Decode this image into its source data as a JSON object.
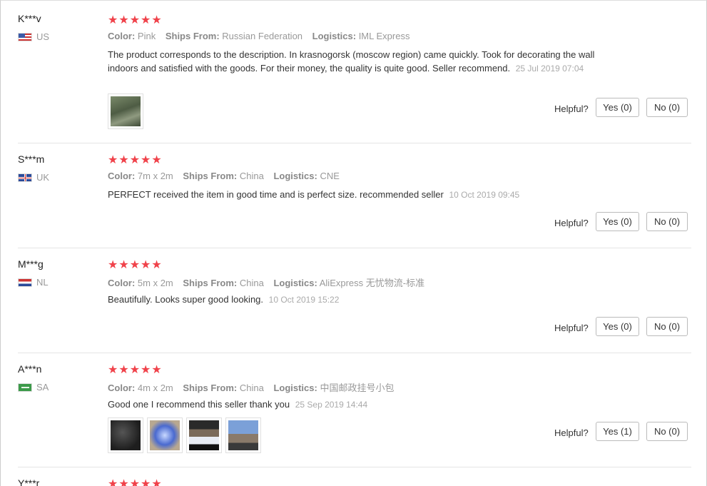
{
  "labels": {
    "color": "Color:",
    "ships_from": "Ships From:",
    "logistics": "Logistics:",
    "helpful": "Helpful?"
  },
  "reviews": [
    {
      "user": "K***v",
      "country": "US",
      "stars": "★★★★★",
      "color": "Pink",
      "ships_from": "Russian Federation",
      "logistics": "IML Express",
      "text": "The product corresponds to the description. In krasnogorsk (moscow region) came quickly. Took for decorating the wall indoors and satisfied with the goods. For their money, the quality is quite good. Seller recommend.",
      "date": "25 Jul 2019 07:04",
      "yes": "Yes (0)",
      "no": "No (0)"
    },
    {
      "user": "S***m",
      "country": "UK",
      "stars": "★★★★★",
      "color": "7m x 2m",
      "ships_from": "China",
      "logistics": "CNE",
      "text": "PERFECT received the item in good time and is perfect size. recommended seller",
      "date": "10 Oct 2019 09:45",
      "yes": "Yes (0)",
      "no": "No (0)"
    },
    {
      "user": "M***g",
      "country": "NL",
      "stars": "★★★★★",
      "color": "5m x 2m",
      "ships_from": "China",
      "logistics": "AliExpress 无忧物流-标准",
      "text": "Beautifully. Looks super good looking.",
      "date": "10 Oct 2019 15:22",
      "yes": "Yes (0)",
      "no": "No (0)"
    },
    {
      "user": "A***n",
      "country": "SA",
      "stars": "★★★★★",
      "color": "4m x 2m",
      "ships_from": "China",
      "logistics": "中国邮政挂号小包",
      "text": "Good one I recommend this seller thank you",
      "date": "25 Sep 2019 14:44",
      "yes": "Yes (1)",
      "no": "No (0)"
    },
    {
      "user": "Y***r",
      "stars": "★★★★★"
    }
  ],
  "colors": {
    "star": "#f0424a",
    "muted": "#999999",
    "separator": "#e5e5e5"
  }
}
